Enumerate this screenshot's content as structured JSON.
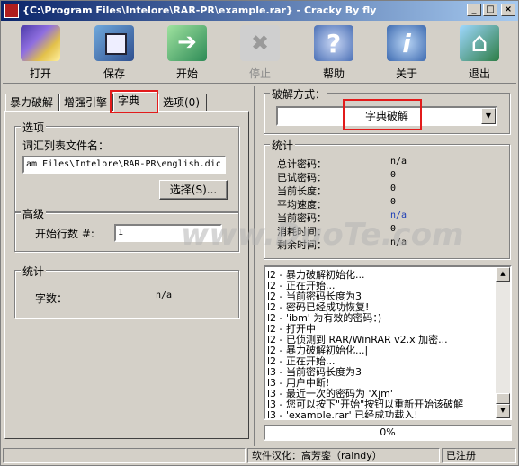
{
  "window": {
    "title": "{C:\\Program Files\\Intelore\\RAR-PR\\example.rar} - Cracky By fly"
  },
  "toolbar": {
    "open": "打开",
    "save": "保存",
    "start": "开始",
    "stop": "停止",
    "help": "帮助",
    "about": "关于",
    "exit": "退出"
  },
  "tabs": [
    "暴力破解",
    "增强引擎",
    "字典",
    "选项(0)"
  ],
  "options": {
    "group_title": "选项",
    "wordlist_label": "词汇列表文件名：",
    "wordlist_value": "am Files\\Intelore\\RAR-PR\\english.dic",
    "select_button": "选择(S)...",
    "advanced_title": "高级",
    "start_line_label": "开始行数 #:",
    "start_line_value": "1",
    "stats_title": "统计",
    "word_count_label": "字数：",
    "word_count_value": "n/a"
  },
  "crack": {
    "method_label": "破解方式：",
    "method_value": "字典破解",
    "stats_title": "统计",
    "stats": [
      {
        "k": "总计密码：",
        "v": "n/a"
      },
      {
        "k": "已试密码：",
        "v": "0"
      },
      {
        "k": "当前长度：",
        "v": "0"
      },
      {
        "k": "平均速度：",
        "v": "0"
      },
      {
        "k": "当前密码：",
        "v": "n/a"
      },
      {
        "k": "消耗时间：",
        "v": "0"
      },
      {
        "k": "剩余时间：",
        "v": "n/a"
      }
    ]
  },
  "log": [
    "l2 - 暴力破解初始化...",
    "l2 - 正在开始...",
    "l2 - 当前密码长度为3",
    "l2 - 密码已经成功恢复!",
    "l2 - 'ibm' 为有效的密码：)",
    "l2 - 打开中",
    "l2 - 已侦测到 RAR/WinRAR v2.x 加密...",
    "l2 - 暴力破解初始化...|",
    "l2 - 正在开始...",
    "l3 - 当前密码长度为3",
    "l3 - 用户中断!",
    "l3 - 最近一次的密码为 'Xjm'",
    "l3 - 您可以按下\"开始\"按钮以重新开始该破解",
    "l3 - 'example.rar' 已经成功载入!"
  ],
  "progress": {
    "text": "0%",
    "value": 0
  },
  "status": {
    "translator": "软件汉化：高芳銮（raindy）",
    "registered": "已注册"
  },
  "watermark": "www.DuoTe.com",
  "colors": {
    "highlight": "#e21b1b",
    "titlebar": "#0a246a",
    "blue_value": "#1c3db6"
  }
}
